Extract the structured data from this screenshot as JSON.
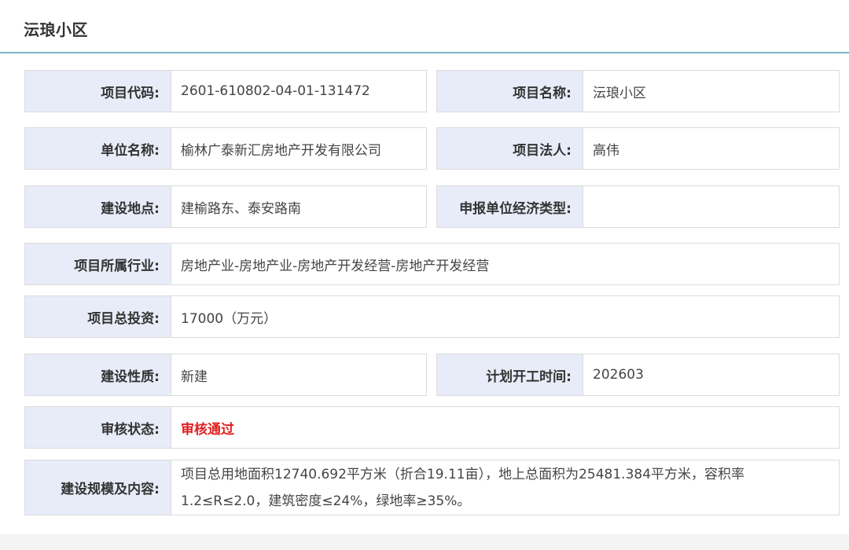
{
  "page": {
    "title": "沄琅小区"
  },
  "fields": {
    "project_code": {
      "label": "项目代码:",
      "value": "2601-610802-04-01-131472"
    },
    "project_name": {
      "label": "项目名称:",
      "value": "沄琅小区"
    },
    "company_name": {
      "label": "单位名称:",
      "value": "榆林广泰新汇房地产开发有限公司"
    },
    "legal_person": {
      "label": "项目法人:",
      "value": "高伟"
    },
    "location": {
      "label": "建设地点:",
      "value": "建榆路东、泰安路南"
    },
    "economic_type": {
      "label": "申报单位经济类型:",
      "value": ""
    },
    "industry": {
      "label": "项目所属行业:",
      "value": "房地产业-房地产业-房地产开发经营-房地产开发经营"
    },
    "investment": {
      "label": "项目总投资:",
      "value": "17000（万元）"
    },
    "nature": {
      "label": "建设性质:",
      "value": "新建"
    },
    "start_time": {
      "label": "计划开工时间:",
      "value": "202603"
    },
    "review_status": {
      "label": "审核状态:",
      "value": "审核通过"
    },
    "scale": {
      "label": "建设规模及内容:",
      "line1": "项目总用地面积12740.692平方米（折合19.11亩），地上总面积为25481.384平方米，容积率",
      "line2": "1.2≤R≤2.0，建筑密度≤24%，绿地率≥35%。"
    }
  },
  "colors": {
    "label_bg": "#e8ecf8",
    "status": "#e02020",
    "header_line": "#7fb6c6"
  }
}
